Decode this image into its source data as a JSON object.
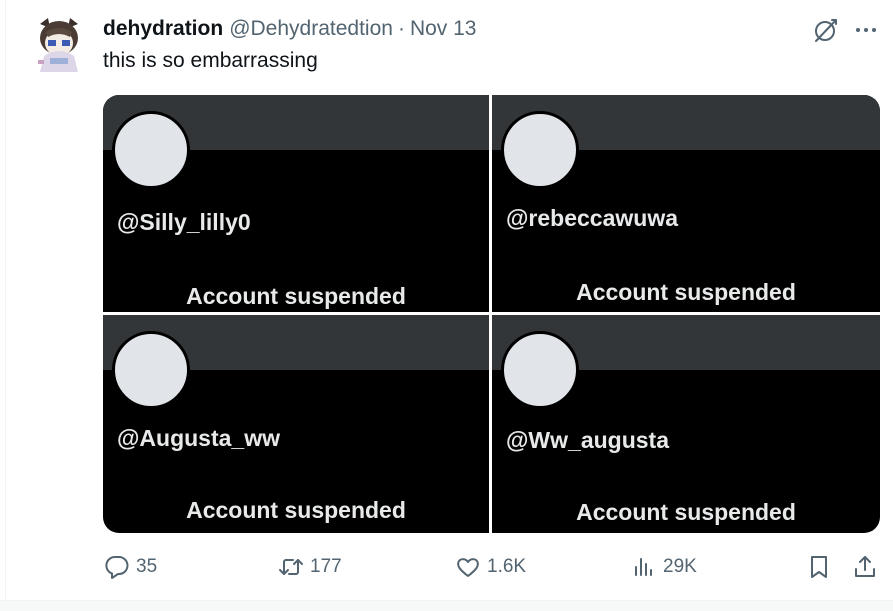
{
  "tweet": {
    "display_name": "dehydration",
    "handle": "@Dehydratedtion",
    "separator": "·",
    "date": "Nov 13",
    "text": "this is so embarrassing"
  },
  "media": [
    {
      "username": "@Silly_lilly0",
      "status": "Account suspended"
    },
    {
      "username": "@rebeccawuwa",
      "status": "Account suspended"
    },
    {
      "username": "@Augusta_ww",
      "status": "Account suspended"
    },
    {
      "username": "@Ww_augusta",
      "status": "Account suspended"
    }
  ],
  "actions": {
    "replies": "35",
    "reposts": "177",
    "likes": "1.6K",
    "views": "29K"
  },
  "icons": {
    "grok": "grok-icon",
    "more": "more-icon",
    "reply": "reply-icon",
    "retweet": "retweet-icon",
    "like": "heart-icon",
    "views": "views-icon",
    "bookmark": "bookmark-icon",
    "share": "share-icon"
  },
  "colors": {
    "text_primary": "#0f1419",
    "text_secondary": "#536471",
    "card_background": "#000000",
    "card_banner": "#333639"
  }
}
